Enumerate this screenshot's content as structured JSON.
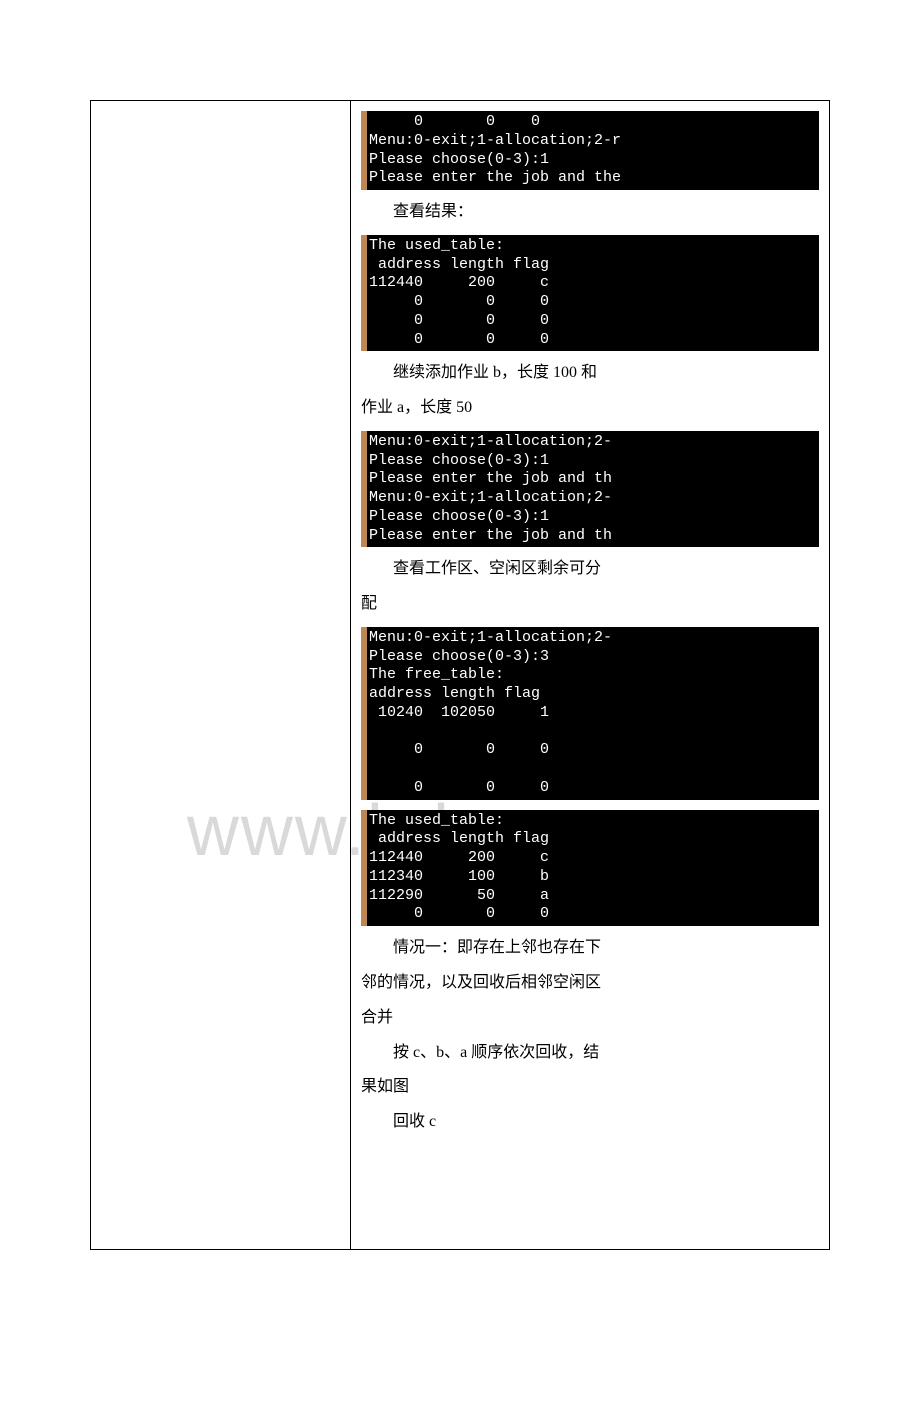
{
  "watermark": "www.bdocx.com",
  "terminals": {
    "t1": "     0       0    0\nMenu:0-exit;1-allocation;2-r\nPlease choose(0-3):1\nPlease enter the job and the",
    "t2": "The used_table:\n address length flag\n112440     200     c\n     0       0     0\n     0       0     0\n     0       0     0",
    "t3": "Menu:0-exit;1-allocation;2-\nPlease choose(0-3):1\nPlease enter the job and th\nMenu:0-exit;1-allocation;2-\nPlease choose(0-3):1\nPlease enter the job and th",
    "t4": "Menu:0-exit;1-allocation;2-\nPlease choose(0-3):3\nThe free_table:\naddress length flag\n 10240  102050     1\n\n     0       0     0\n\n     0       0     0",
    "t5": "The used_table:\n address length flag\n112440     200     c\n112340     100     b\n112290      50     a\n     0       0     0"
  },
  "paragraphs": {
    "p1": "查看结果：",
    "p2_a": "继续添加作业 b，长度 100 和",
    "p2_b": "作业 a，长度 50",
    "p3_a": "查看工作区、空闲区剩余可分",
    "p3_b": "配",
    "p4_a": "情况一：即存在上邻也存在下",
    "p4_b": "邻的情况，以及回收后相邻空闲区",
    "p4_c": "合并",
    "p5_a": "按 c、b、a 顺序依次回收，结",
    "p5_b": "果如图",
    "p6": "回收 c"
  }
}
